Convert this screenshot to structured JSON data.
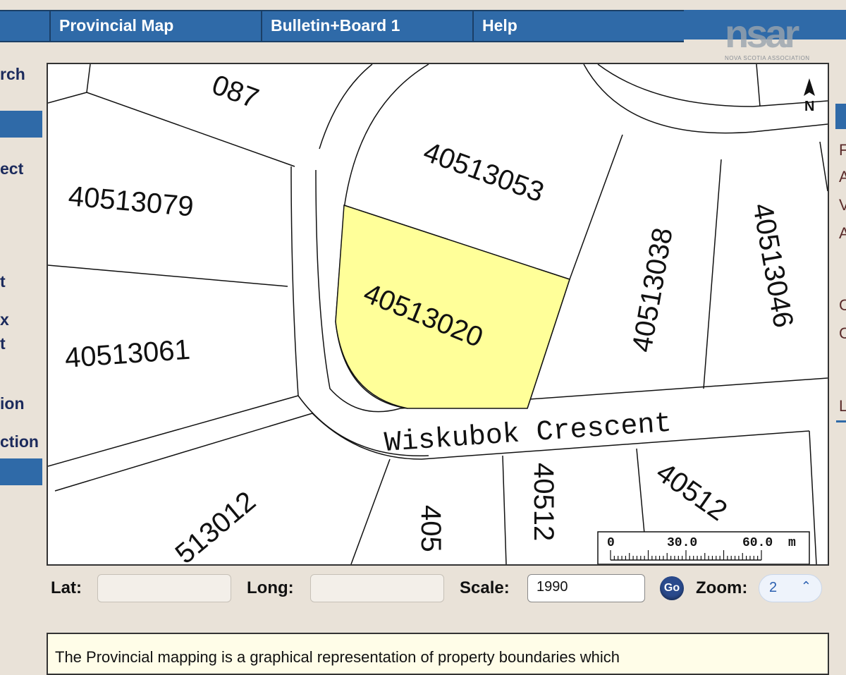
{
  "topnav": {
    "tabs": [
      {
        "label": "Provincial Map"
      },
      {
        "label": "Bulletin+Board 1"
      },
      {
        "label": "Help"
      }
    ]
  },
  "logo": {
    "text": "nsar",
    "subtitle": "NOVA SCOTIA ASSOCIATION"
  },
  "sidebar": {
    "items": [
      {
        "label": "rch"
      },
      {
        "label": "ect"
      },
      {
        "label": "t"
      },
      {
        "label": "x"
      },
      {
        "label": "t"
      },
      {
        "label": "ion"
      },
      {
        "label": "ction"
      }
    ]
  },
  "map": {
    "parcels": [
      {
        "id": "087"
      },
      {
        "id": "40513079"
      },
      {
        "id": "40513053"
      },
      {
        "id": "40513020",
        "highlighted": true
      },
      {
        "id": "40513038"
      },
      {
        "id": "40513046"
      },
      {
        "id": "40513061"
      },
      {
        "id": "513012"
      },
      {
        "id": "405"
      },
      {
        "id": "40512"
      },
      {
        "id": "40512"
      }
    ],
    "street": "Wiskubok  Crescent",
    "north_label": "N",
    "scale_bar": {
      "ticks": [
        "0",
        "30.0",
        "60.0"
      ],
      "unit": "m"
    },
    "highlight_color": "#ffff99"
  },
  "right_edge": {
    "chars": [
      "F",
      "A",
      "V",
      "A",
      "C",
      "C",
      "L"
    ]
  },
  "controls": {
    "lat_label": "Lat:",
    "lat_value": "",
    "long_label": "Long:",
    "long_value": "",
    "scale_label": "Scale:",
    "scale_value": "1990",
    "go_label": "Go",
    "zoom_label": "Zoom:",
    "zoom_value": "2"
  },
  "notice": {
    "text": "The Provincial mapping is a graphical representation of property boundaries which"
  },
  "colors": {
    "nav_blue": "#2f6aa8",
    "background": "#e9e2d8",
    "notice_bg": "#fffde8"
  }
}
